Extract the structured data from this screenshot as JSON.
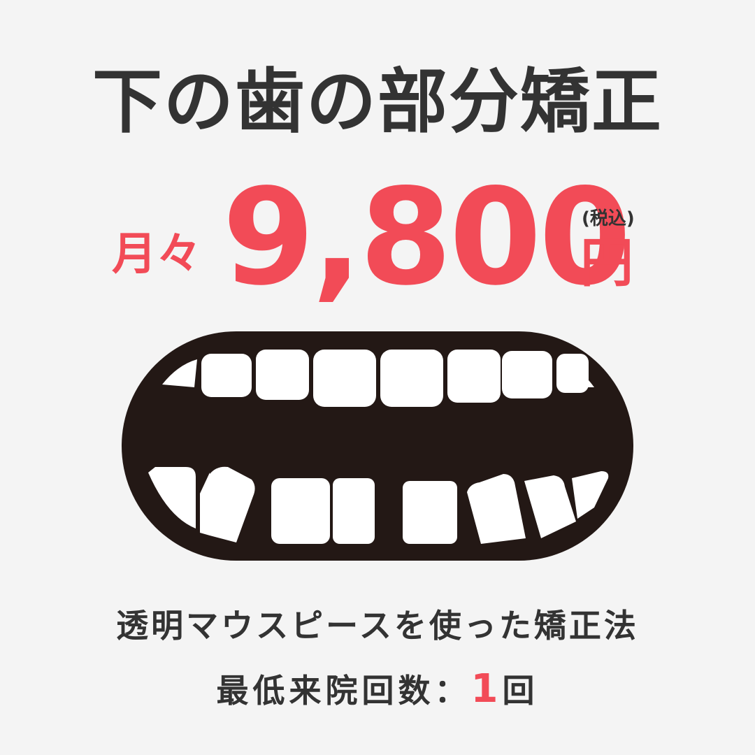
{
  "title": "下の歯の部分矯正",
  "price": {
    "prefix": "月々",
    "amount": "9,800",
    "tax_note": "(税込)",
    "unit": "円"
  },
  "description": "透明マウスピースを使った矯正法",
  "visits": {
    "label": "最低来院回数：",
    "value": "1",
    "unit": "回"
  },
  "colors": {
    "background": "#f4f4f4",
    "text": "#333333",
    "accent": "#f24b57",
    "mouth": "#231815",
    "teeth": "#ffffff"
  },
  "illustration": "mouth-teeth-icon"
}
